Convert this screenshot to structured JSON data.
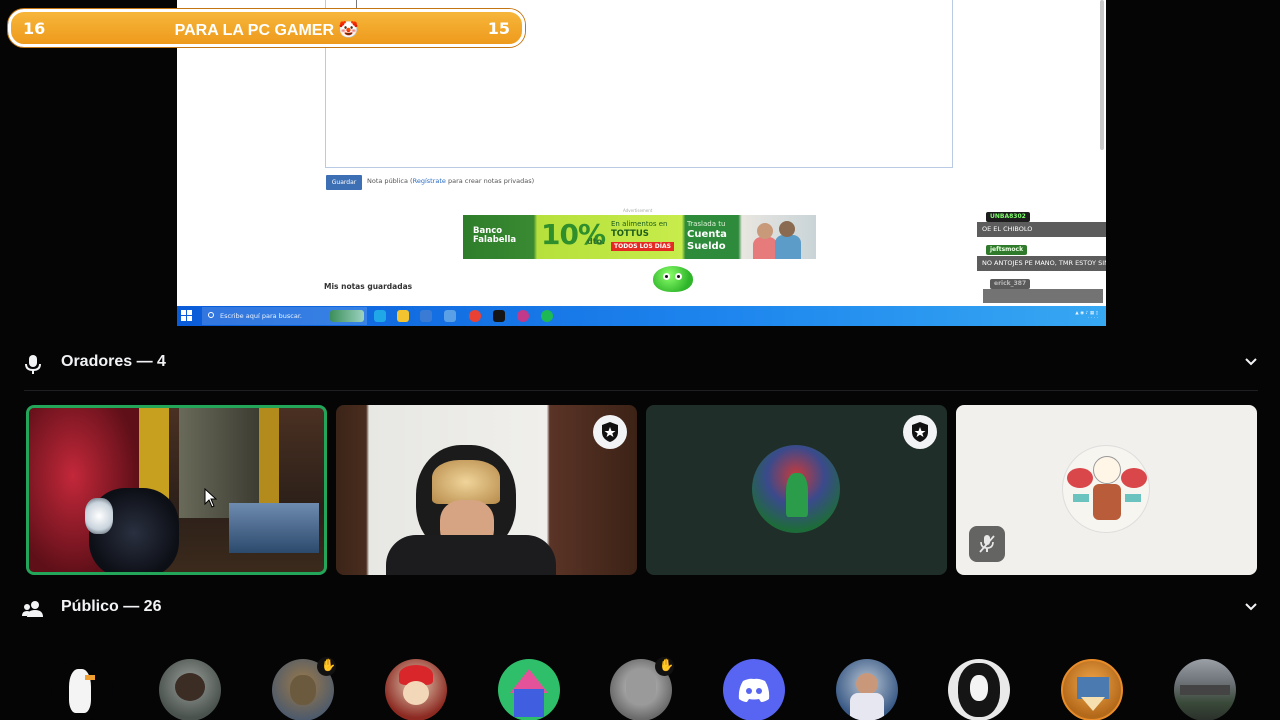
{
  "banner": {
    "left_number": "16",
    "title": "PARA LA PC GAMER 🤡",
    "right_number": "15"
  },
  "shared_screen": {
    "save_button": "Guardar",
    "note_prefix": "Nota pública (",
    "note_link": "Regístrate",
    "note_suffix": " para crear notas privadas)",
    "ad_label": "Advertisement",
    "ad": {
      "brand": "Banco Falabella",
      "percent": "10%",
      "dto": "dto.",
      "food": "En alimentos en",
      "store": "TOTTUS",
      "days": "TODOS LOS DÍAS",
      "move": "Traslada tu",
      "account": "Cuenta Sueldo"
    },
    "saved_notes": "Mis notas guardadas",
    "taskbar_search": "Escribe aquí para buscar."
  },
  "chat": [
    {
      "user": "UNBA8302",
      "message": "OE EL CHIBOLO",
      "user_color": "#3fc83a"
    },
    {
      "user": "jeftsmock",
      "message": "NO ANTOJES PE MANO, TMR ESTOY SIN CENAR PIPIPI",
      "user_color": "#3b8f36"
    },
    {
      "user": "erick_387",
      "message": "",
      "user_color": "#6a6a6a"
    }
  ],
  "speakers": {
    "label": "Oradores — 4"
  },
  "audience": {
    "label": "Público — 26"
  },
  "colors": {
    "accent_green": "#23a55a",
    "background": "#050506",
    "banner_orange": "#f2a62a"
  },
  "icons": {
    "speakers": "microphone-icon",
    "audience": "people-icon",
    "collapse": "chevron-down-icon",
    "moderator": "moderator-shield-icon",
    "muted": "microphone-muted-icon",
    "raised_hand": "raised-hand-icon"
  }
}
